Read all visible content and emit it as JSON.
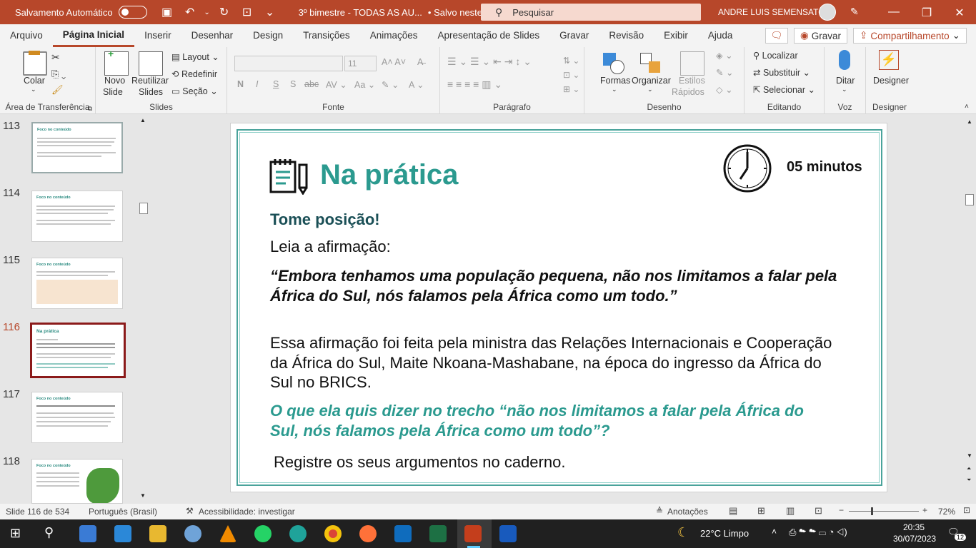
{
  "titlebar": {
    "autosave_label": "Salvamento Automático",
    "doc_title": "3º bimestre - TODAS AS AU...",
    "save_status": "• Salvo neste PC",
    "search_placeholder": "Pesquisar",
    "user_name": "ANDRE LUIS SEMENSATO"
  },
  "tabs": [
    "Arquivo",
    "Página Inicial",
    "Inserir",
    "Desenhar",
    "Design",
    "Transições",
    "Animações",
    "Apresentação de Slides",
    "Gravar",
    "Revisão",
    "Exibir",
    "Ajuda"
  ],
  "tab_actions": {
    "record": "Gravar",
    "share": "Compartilhamento"
  },
  "ribbon": {
    "clipboard": {
      "label": "Área de Transferência",
      "paste": "Colar"
    },
    "slides": {
      "label": "Slides",
      "new_slide_1": "Novo",
      "new_slide_2": "Slide",
      "reuse_1": "Reutilizar",
      "reuse_2": "Slides",
      "layout": "Layout",
      "reset": "Redefinir",
      "section": "Seção"
    },
    "font": {
      "label": "Fonte",
      "size": "11",
      "bold": "N",
      "italic": "I",
      "underline": "S",
      "shadow": "S",
      "strike": "abc"
    },
    "paragraph": {
      "label": "Parágrafo"
    },
    "drawing": {
      "label": "Desenho",
      "shapes": "Formas",
      "arrange": "Organizar",
      "styles_1": "Estilos",
      "styles_2": "Rápidos"
    },
    "editing": {
      "label": "Editando",
      "find": "Localizar",
      "replace": "Substituir",
      "select": "Selecionar"
    },
    "voice": {
      "label": "Voz",
      "dictate": "Ditar"
    },
    "designer": {
      "label": "Designer",
      "button": "Designer"
    }
  },
  "slides_panel": {
    "items": [
      {
        "num": "113",
        "title": "Foco no conteúdo"
      },
      {
        "num": "114",
        "title": "Foco no conteúdo"
      },
      {
        "num": "115",
        "title": "Foco no conteúdo"
      },
      {
        "num": "116",
        "title": "Na prática"
      },
      {
        "num": "117",
        "title": "Foco no conteúdo"
      },
      {
        "num": "118",
        "title": "Foco no conteúdo"
      }
    ]
  },
  "slide": {
    "heading": "Na prática",
    "time": "05 minutos",
    "subheading": "Tome posição!",
    "intro": "Leia a afirmação:",
    "quote": "“Embora tenhamos uma população pequena, não nos limitamos a falar pela África do Sul, nós falamos pela África como um todo.”",
    "context": "Essa afirmação foi feita pela ministra das Relações Internacionais e Cooperação da África do Sul, Maite Nkoana-Mashabane, na época do ingresso da África do Sul no BRICS.",
    "question": "O que ela quis dizer no trecho “não nos limitamos a falar pela África do Sul, nós falamos pela África como um todo”?",
    "instruction": "Registre os seus argumentos no caderno.",
    "accent_color": "#2b9a8f"
  },
  "status": {
    "slide_count": "Slide 116 de 534",
    "language": "Português (Brasil)",
    "accessibility": "Acessibilidade: investigar",
    "notes": "Anotações",
    "zoom": "72%"
  },
  "taskbar": {
    "weather": "22°C  Limpo",
    "time": "20:35",
    "date": "30/07/2023",
    "notifications": "12"
  }
}
